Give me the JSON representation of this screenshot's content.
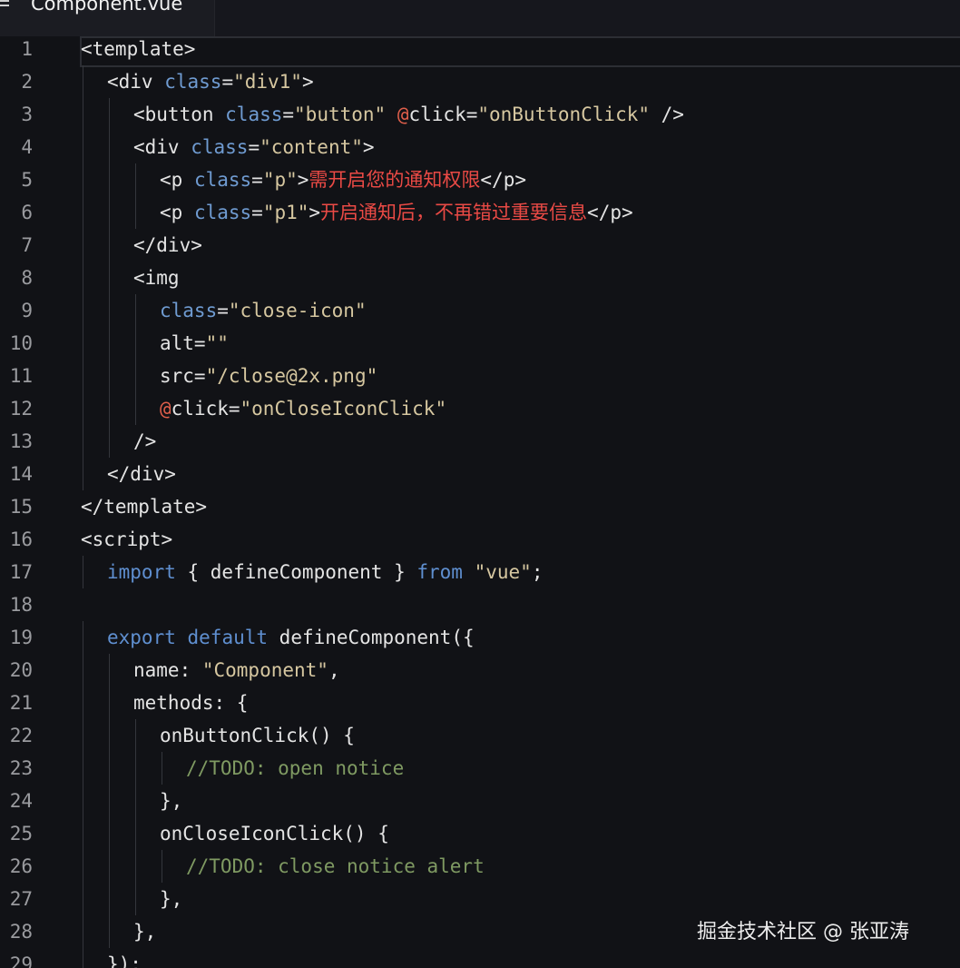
{
  "tab": {
    "title": "Component.vue",
    "icon": "menu-icon"
  },
  "editor": {
    "lines": [
      {
        "n": "1",
        "indent": 0,
        "tokens": [
          [
            "plain",
            "<template>"
          ]
        ]
      },
      {
        "n": "2",
        "indent": 1,
        "tokens": [
          [
            "plain",
            "<div "
          ],
          [
            "attr",
            "class"
          ],
          [
            "plain",
            "="
          ],
          [
            "str",
            "\"div1\""
          ],
          [
            "plain",
            ">"
          ]
        ]
      },
      {
        "n": "3",
        "indent": 2,
        "tokens": [
          [
            "plain",
            "<button "
          ],
          [
            "attr",
            "class"
          ],
          [
            "plain",
            "="
          ],
          [
            "str",
            "\"button\""
          ],
          [
            "plain",
            " "
          ],
          [
            "at",
            "@"
          ],
          [
            "plain",
            "click="
          ],
          [
            "str",
            "\"onButtonClick\""
          ],
          [
            "plain",
            " />"
          ]
        ]
      },
      {
        "n": "4",
        "indent": 2,
        "tokens": [
          [
            "plain",
            "<div "
          ],
          [
            "attr",
            "class"
          ],
          [
            "plain",
            "="
          ],
          [
            "str",
            "\"content\""
          ],
          [
            "plain",
            ">"
          ]
        ]
      },
      {
        "n": "5",
        "indent": 3,
        "tokens": [
          [
            "plain",
            "<p "
          ],
          [
            "attr",
            "class"
          ],
          [
            "plain",
            "="
          ],
          [
            "str",
            "\"p\""
          ],
          [
            "plain",
            ">"
          ],
          [
            "zh",
            "需开启您的通知权限"
          ],
          [
            "plain",
            "</p>"
          ]
        ]
      },
      {
        "n": "6",
        "indent": 3,
        "tokens": [
          [
            "plain",
            "<p "
          ],
          [
            "attr",
            "class"
          ],
          [
            "plain",
            "="
          ],
          [
            "str",
            "\"p1\""
          ],
          [
            "plain",
            ">"
          ],
          [
            "zh",
            "开启通知后，不再错过重要信息"
          ],
          [
            "plain",
            "</p>"
          ]
        ]
      },
      {
        "n": "7",
        "indent": 2,
        "tokens": [
          [
            "plain",
            "</div>"
          ]
        ]
      },
      {
        "n": "8",
        "indent": 2,
        "tokens": [
          [
            "plain",
            "<img"
          ]
        ]
      },
      {
        "n": "9",
        "indent": 3,
        "tokens": [
          [
            "attr",
            "class"
          ],
          [
            "plain",
            "="
          ],
          [
            "str",
            "\"close-icon\""
          ]
        ]
      },
      {
        "n": "10",
        "indent": 3,
        "tokens": [
          [
            "plain",
            "alt="
          ],
          [
            "str",
            "\"\""
          ]
        ]
      },
      {
        "n": "11",
        "indent": 3,
        "tokens": [
          [
            "plain",
            "src="
          ],
          [
            "str",
            "\"/close@2x.png\""
          ]
        ]
      },
      {
        "n": "12",
        "indent": 3,
        "tokens": [
          [
            "at",
            "@"
          ],
          [
            "plain",
            "click="
          ],
          [
            "str",
            "\"onCloseIconClick\""
          ]
        ]
      },
      {
        "n": "13",
        "indent": 2,
        "tokens": [
          [
            "plain",
            "/>"
          ]
        ]
      },
      {
        "n": "14",
        "indent": 1,
        "tokens": [
          [
            "plain",
            "</div>"
          ]
        ]
      },
      {
        "n": "15",
        "indent": 0,
        "tokens": [
          [
            "plain",
            "</template>"
          ]
        ]
      },
      {
        "n": "16",
        "indent": 0,
        "tokens": [
          [
            "plain",
            "<script>"
          ]
        ]
      },
      {
        "n": "17",
        "indent": 1,
        "tokens": [
          [
            "kw",
            "import"
          ],
          [
            "plain",
            " { defineComponent } "
          ],
          [
            "kw",
            "from"
          ],
          [
            "plain",
            " "
          ],
          [
            "str",
            "\"vue\""
          ],
          [
            "plain",
            ";"
          ]
        ]
      },
      {
        "n": "18",
        "indent": 0,
        "tokens": []
      },
      {
        "n": "19",
        "indent": 1,
        "tokens": [
          [
            "kw",
            "export"
          ],
          [
            "plain",
            " "
          ],
          [
            "kw",
            "default"
          ],
          [
            "plain",
            " defineComponent({"
          ]
        ]
      },
      {
        "n": "20",
        "indent": 2,
        "tokens": [
          [
            "plain",
            "name: "
          ],
          [
            "str",
            "\"Component\""
          ],
          [
            "plain",
            ","
          ]
        ]
      },
      {
        "n": "21",
        "indent": 2,
        "tokens": [
          [
            "plain",
            "methods: {"
          ]
        ]
      },
      {
        "n": "22",
        "indent": 3,
        "tokens": [
          [
            "plain",
            "onButtonClick() {"
          ]
        ]
      },
      {
        "n": "23",
        "indent": 4,
        "tokens": [
          [
            "cmt",
            "//TODO: open notice"
          ]
        ]
      },
      {
        "n": "24",
        "indent": 3,
        "tokens": [
          [
            "plain",
            "},"
          ]
        ]
      },
      {
        "n": "25",
        "indent": 3,
        "tokens": [
          [
            "plain",
            "onCloseIconClick() {"
          ]
        ]
      },
      {
        "n": "26",
        "indent": 4,
        "tokens": [
          [
            "cmt",
            "//TODO: close notice alert"
          ]
        ]
      },
      {
        "n": "27",
        "indent": 3,
        "tokens": [
          [
            "plain",
            "},"
          ]
        ]
      },
      {
        "n": "28",
        "indent": 2,
        "tokens": [
          [
            "plain",
            "},"
          ]
        ]
      },
      {
        "n": "29",
        "indent": 1,
        "tokens": [
          [
            "plain",
            "});"
          ]
        ]
      }
    ]
  },
  "watermark": {
    "text": "掘金技术社区 @ 张亚涛"
  }
}
